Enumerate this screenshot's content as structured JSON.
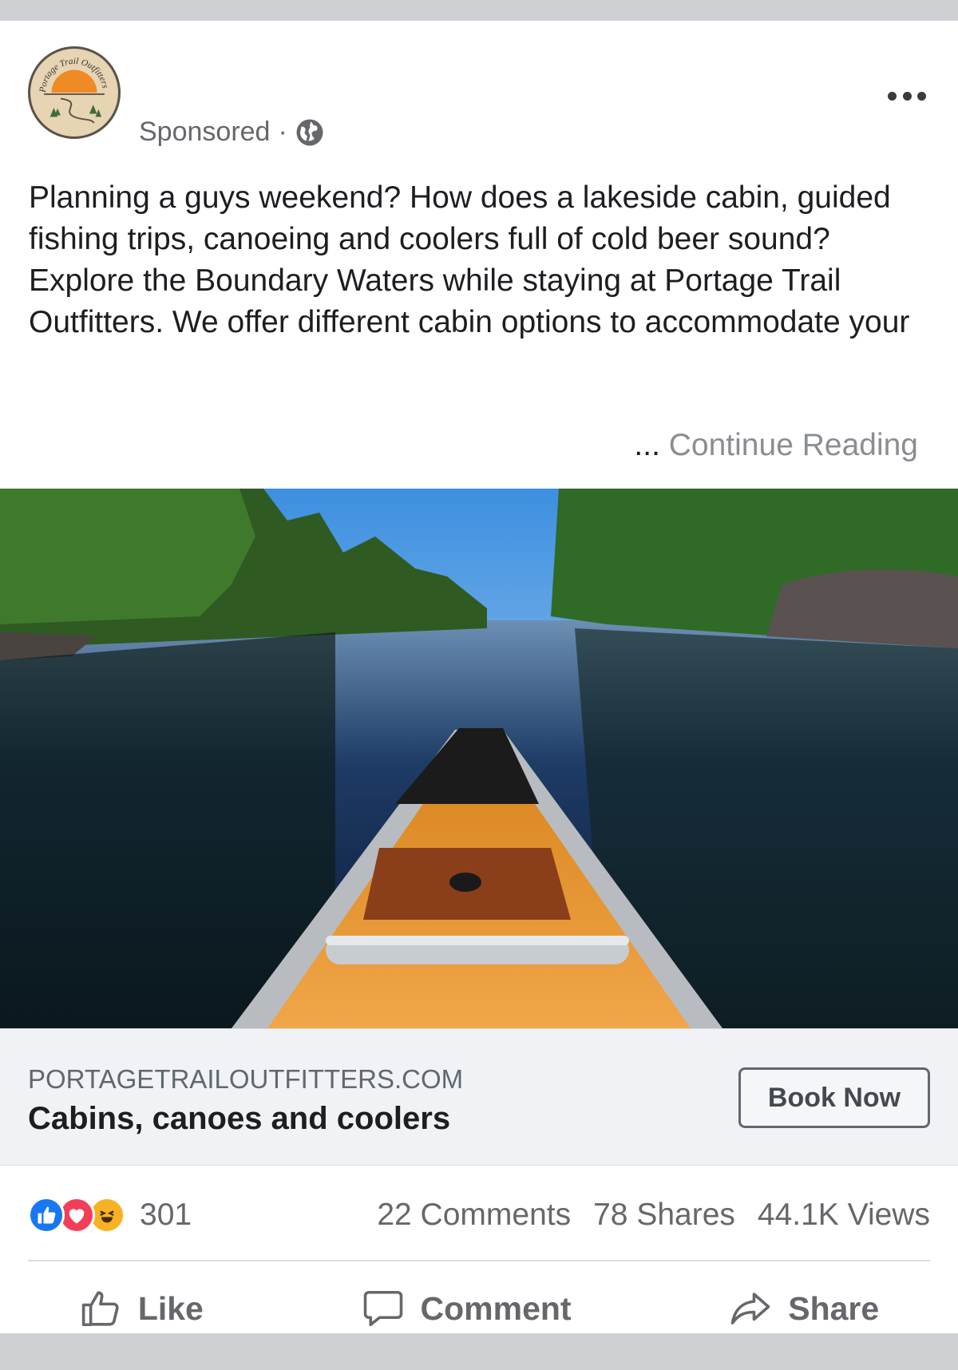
{
  "post": {
    "page_name_hidden": "",
    "sponsored_label": "Sponsored",
    "separator": "·",
    "privacy_icon": "globe-icon",
    "more_icon": "more-options-icon",
    "text": "Planning a guys weekend? How does a lakeside cabin, guided fishing trips, canoeing and coolers full of cold beer sound? Explore the Boundary Waters while staying at Portage Trail Outfitters. We offer different cabin options to accommodate your",
    "continue_ellipsis": "...",
    "continue_label": "Continue Reading",
    "avatar_logo_text": "Portage Trail Outfitters"
  },
  "link_preview": {
    "domain": "PORTAGETRAILOUTFITTERS.COM",
    "headline": "Cabins, canoes and coolers",
    "cta_label": "Book Now"
  },
  "stats": {
    "reaction_icons": [
      "like-reaction-icon",
      "love-reaction-icon",
      "haha-reaction-icon"
    ],
    "reaction_count": "301",
    "comments": "22 Comments",
    "shares": "78 Shares",
    "views": "44.1K Views"
  },
  "actions": {
    "like": "Like",
    "comment": "Comment",
    "share": "Share"
  },
  "colors": {
    "like_blue": "#1877f2",
    "love_red": "#f33e58",
    "haha_yellow": "#f7b125",
    "secondary_text": "#65676b"
  }
}
